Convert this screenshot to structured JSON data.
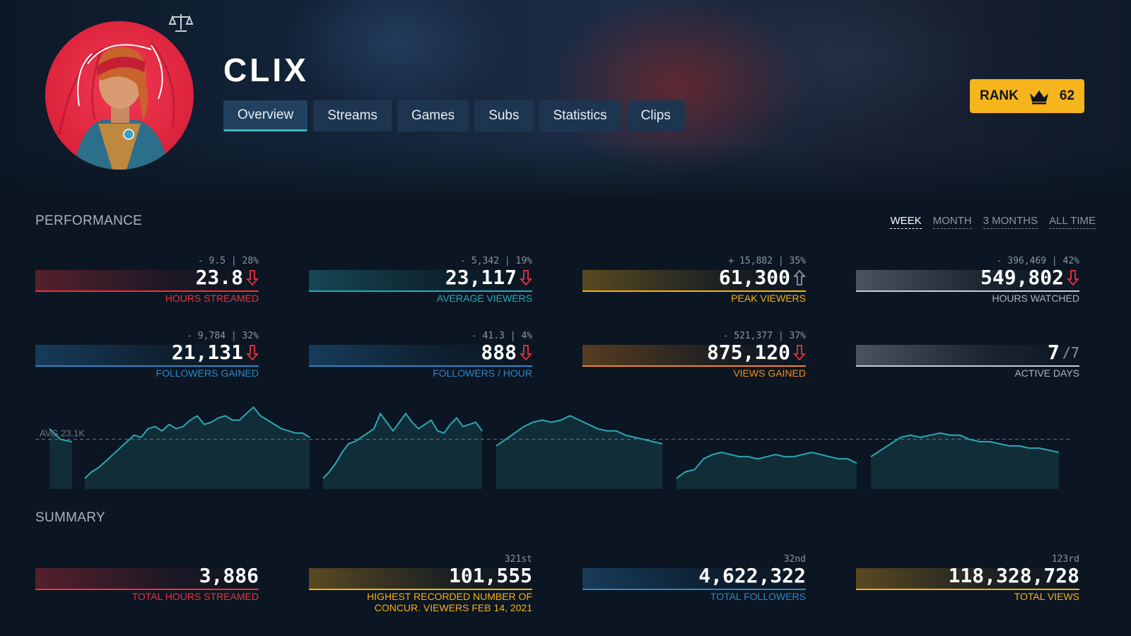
{
  "streamer": {
    "name": "CLIX"
  },
  "tabs": [
    {
      "label": "Overview",
      "active": true
    },
    {
      "label": "Streams",
      "active": false
    },
    {
      "label": "Games",
      "active": false
    },
    {
      "label": "Subs",
      "active": false
    },
    {
      "label": "Statistics",
      "active": false
    },
    {
      "label": "Clips",
      "active": false
    }
  ],
  "rank": {
    "label": "RANK",
    "icon": "crown-icon",
    "value": "62",
    "color": "#f7b51d"
  },
  "performance": {
    "title": "PERFORMANCE",
    "periods": [
      {
        "label": "WEEK",
        "active": true
      },
      {
        "label": "MONTH",
        "active": false
      },
      {
        "label": "3 MONTHS",
        "active": false
      },
      {
        "label": "ALL TIME",
        "active": false
      }
    ],
    "stats": [
      {
        "delta": "- 9.5 | 28%",
        "value": "23.8",
        "trend": "down",
        "label": "HOURS STREAMED",
        "color": "#e8343f"
      },
      {
        "delta": "- 5,342 | 19%",
        "value": "23,117",
        "trend": "down",
        "label": "AVERAGE VIEWERS",
        "color": "#2aa9b8"
      },
      {
        "delta": "+ 15,882 | 35%",
        "value": "61,300",
        "trend": "up",
        "label": "PEAK VIEWERS",
        "color": "#f5b01f"
      },
      {
        "delta": "- 396,469 | 42%",
        "value": "549,802",
        "trend": "down",
        "label": "HOURS WATCHED",
        "color": "#c6ccd4"
      },
      {
        "delta": "- 9,784 | 32%",
        "value": "21,131",
        "trend": "down",
        "label": "FOLLOWERS GAINED",
        "color": "#2f86c9"
      },
      {
        "delta": "- 41.3 | 4%",
        "value": "888",
        "trend": "down",
        "label": "FOLLOWERS / HOUR",
        "color": "#2f86c9"
      },
      {
        "delta": "- 521,377 | 37%",
        "value": "875,120",
        "trend": "down",
        "label": "VIEWS GAINED",
        "color": "#f08a1c"
      },
      {
        "delta": "",
        "value": "7",
        "denominator": "/7",
        "trend": "none",
        "label": "ACTIVE DAYS",
        "color": "#c6ccd4"
      }
    ],
    "chart_avg_label": "AVG 23.1K"
  },
  "chart_data": {
    "type": "area",
    "title": "",
    "avg_label": "AVG 23.1K",
    "avg_value": 23.1,
    "ylabel": "",
    "ylim": [
      0,
      42
    ],
    "line_color": "#2aa9b8",
    "series": [
      {
        "values": [
          28,
          23,
          22
        ]
      },
      {
        "values": [
          5,
          8,
          10,
          13,
          16,
          19,
          22,
          25,
          24,
          28,
          29,
          27,
          30,
          28,
          29,
          32,
          34,
          30,
          31,
          33,
          34,
          32,
          32,
          35,
          38,
          34,
          32,
          30,
          28,
          27,
          26,
          26,
          24
        ]
      },
      {
        "values": [
          5,
          8,
          12,
          17,
          21,
          22,
          24,
          26,
          28,
          35,
          31,
          27,
          31,
          35,
          31,
          28,
          30,
          32,
          27,
          26,
          30,
          33,
          29,
          30,
          31,
          27
        ]
      },
      {
        "values": [
          20,
          23,
          26,
          29,
          31,
          32,
          31,
          32,
          34,
          32,
          30,
          28,
          27,
          27,
          25,
          24,
          23,
          22,
          21
        ]
      },
      {
        "values": [
          5,
          8,
          9,
          14,
          16,
          17,
          16,
          15,
          15,
          14,
          15,
          16,
          15,
          15,
          16,
          17,
          16,
          15,
          14,
          14,
          12
        ]
      },
      {
        "values": [
          15,
          18,
          21,
          24,
          25,
          24,
          25,
          26,
          25,
          25,
          23,
          22,
          22,
          21,
          20,
          20,
          19,
          19,
          18,
          17
        ]
      }
    ]
  },
  "summary": {
    "title": "SUMMARY",
    "stats": [
      {
        "rank": "",
        "value": "3,886",
        "label": "TOTAL HOURS STREAMED",
        "color": "#e8343f"
      },
      {
        "rank": "321st",
        "value": "101,555",
        "label": "HIGHEST RECORDED NUMBER OF CONCUR. VIEWERS FEB 14, 2021",
        "label_line1": "HIGHEST RECORDED NUMBER OF",
        "label_line2": "CONCUR. VIEWERS FEB 14, 2021",
        "color": "#f5b01f"
      },
      {
        "rank": "32nd",
        "value": "4,622,322",
        "label": "TOTAL FOLLOWERS",
        "color": "#2f86c9"
      },
      {
        "rank": "123rd",
        "value": "118,328,728",
        "label": "TOTAL VIEWS",
        "color": "#f5b01f"
      }
    ]
  }
}
